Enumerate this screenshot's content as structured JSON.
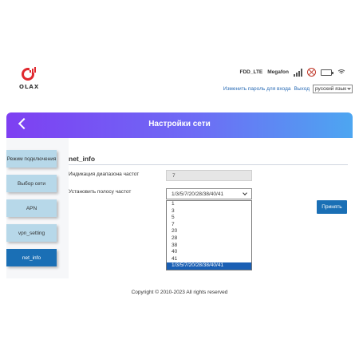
{
  "header": {
    "logo_text": "OLAX",
    "network_type": "FDD_LTE",
    "operator": "Megafon",
    "signal_bars": 4,
    "battery_level": 1.0,
    "change_password_link": "Изменить пароль для входа",
    "logout_link": "Выход",
    "language_selected": "русский язык"
  },
  "banner": {
    "title": "Настройки сети"
  },
  "sidebar": {
    "items": [
      {
        "label": "Режим подключения"
      },
      {
        "label": "Выбор сети"
      },
      {
        "label": "APN"
      },
      {
        "label": "vpn_setting"
      },
      {
        "label": "net_info"
      }
    ],
    "active_index": 4
  },
  "panel": {
    "title": "net_info",
    "band_indication_label": "Индикация диапазона частот",
    "band_indication_value": "7",
    "set_band_label": "Установить полосу частот",
    "set_band_value": "1/3/5/7/20/28/38/40/41",
    "band_options": [
      "1",
      "3",
      "5",
      "7",
      "20",
      "28",
      "38",
      "40",
      "41",
      "1/3/5/7/20/28/38/40/41"
    ],
    "selected_option_index": 9,
    "apply_label": "Принять"
  },
  "footer": {
    "copyright": "Copyright © 2010-2023 All rights reserved"
  },
  "colors": {
    "accent_blue": "#1a6fb5",
    "nav_item_bg": "#b7d8e9",
    "banner_gradient_start": "#7e3ff2",
    "banner_gradient_end": "#4da6f1",
    "logo_red": "#e0282e",
    "link_blue": "#2a6cb6"
  },
  "icons": {
    "back": "chevron-left-icon",
    "signal": "signal-bars-icon",
    "globe": "globe-icon",
    "battery": "battery-icon",
    "wifi": "wifi-icon"
  }
}
